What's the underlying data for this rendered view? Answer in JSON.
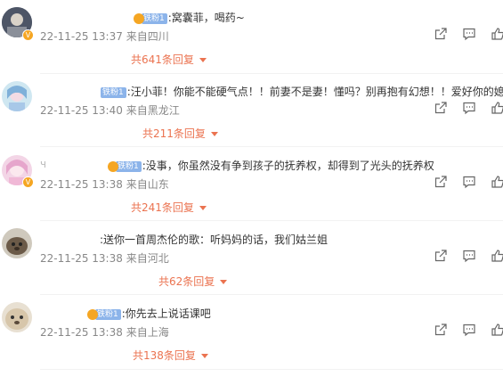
{
  "comments": [
    {
      "text": ":窝囊菲，喝药~",
      "badge": "铁粉1",
      "time": "22-11-25 13:37",
      "location": "来自四川",
      "replies": "共641条回复"
    },
    {
      "text": ":汪小菲！你能不能硬气点！！前妻不是妻！懂吗？别再抱有幻想！！爱好你的媳",
      "badge": "铁粉1",
      "time": "22-11-25 13:40",
      "location": "来自黑龙江",
      "replies": "共211条回复"
    },
    {
      "text": ":没事，你虽然没有争到孩子的抚养权，却得到了光头的抚养权",
      "badge": "铁粉1",
      "name_fragment": "ч",
      "time": "22-11-25 13:38",
      "location": "来自山东",
      "replies": "共241条回复"
    },
    {
      "text": ":送你一首周杰伦的歌：听妈妈的话，我们姑兰姐",
      "badge": "",
      "time": "22-11-25 13:38",
      "location": "来自河北",
      "replies": "共62条回复"
    },
    {
      "text": ":你先去上说话课吧",
      "badge": "铁粉1",
      "time": "22-11-25 13:38",
      "location": "来自上海",
      "replies": "共138条回复"
    }
  ],
  "icons": {
    "share": "share-icon",
    "comment": "comment-icon",
    "like": "like-icon"
  },
  "colors": {
    "reply_link": "#eb7350",
    "fan_badge": "#8cb4ea",
    "meta_text": "#888888"
  }
}
